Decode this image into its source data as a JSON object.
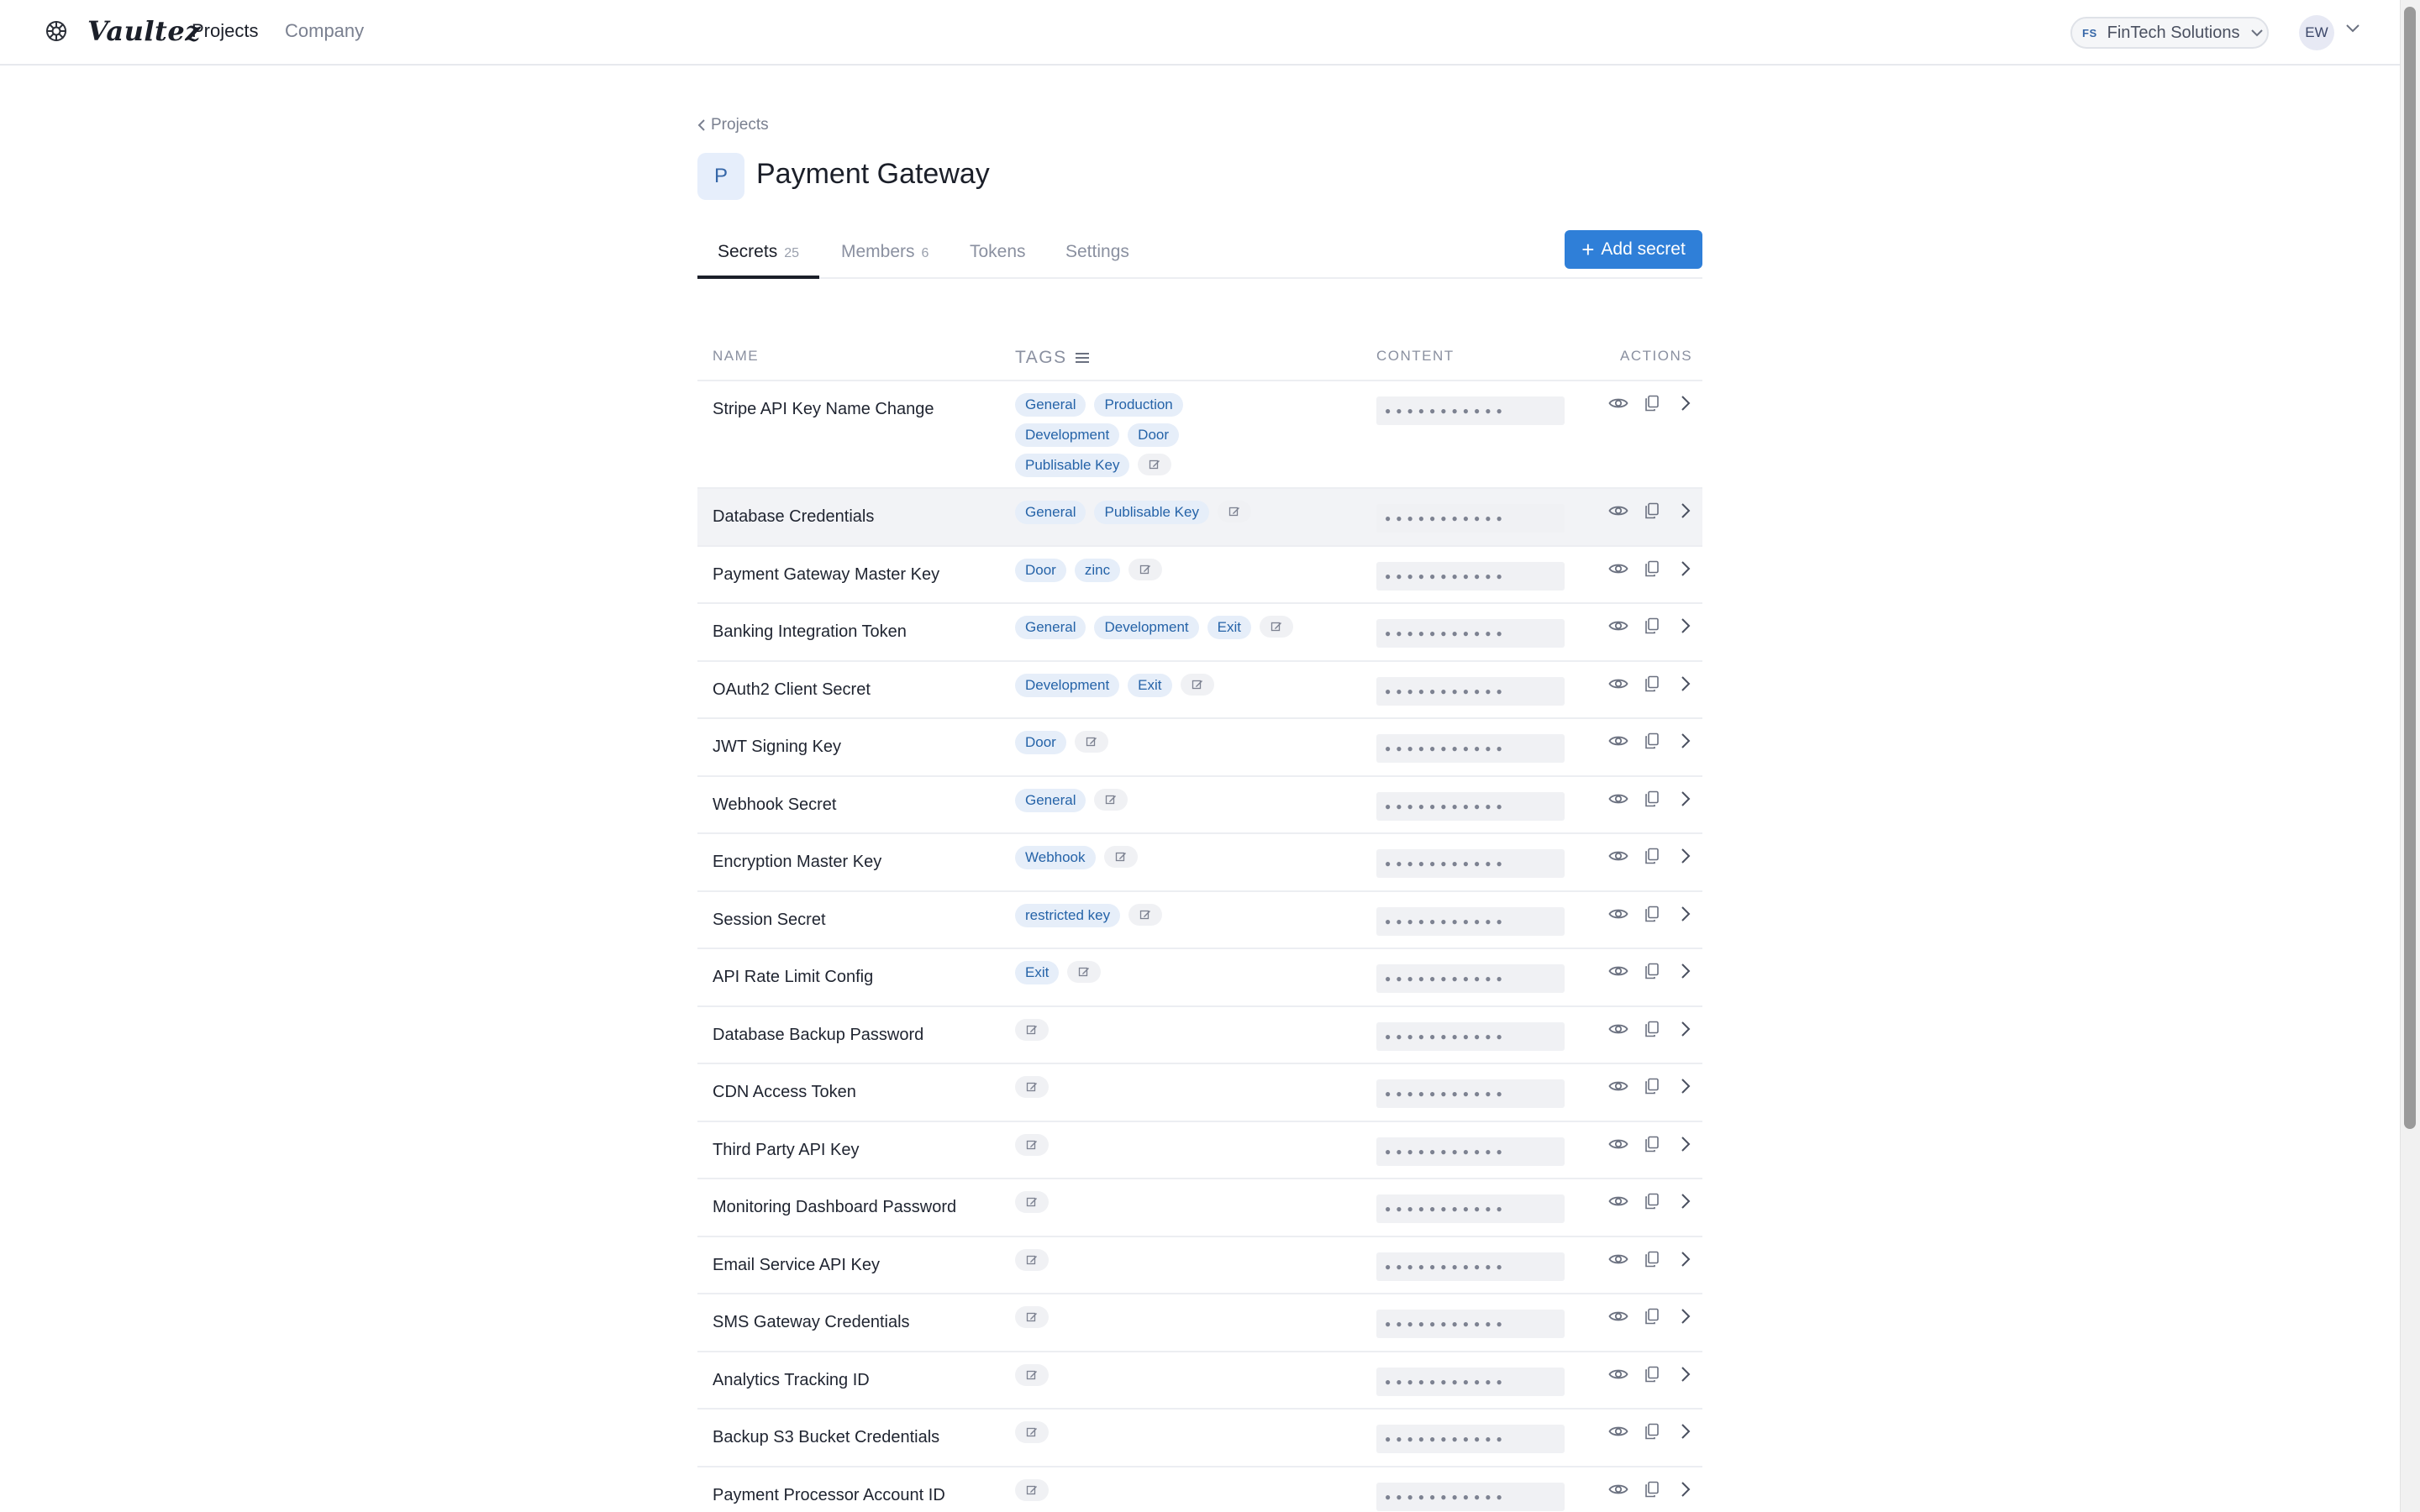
{
  "header": {
    "brand": "Vaultez",
    "nav": [
      {
        "label": "Projects",
        "active": true
      },
      {
        "label": "Company",
        "active": false
      }
    ],
    "org": {
      "badge": "FS",
      "name": "FinTech Solutions"
    },
    "user": {
      "initials": "EW"
    }
  },
  "page": {
    "back_label": "Projects",
    "project_initial": "P",
    "project_title": "Payment Gateway"
  },
  "tabs": [
    {
      "label": "Secrets",
      "count": "25",
      "active": true
    },
    {
      "label": "Members",
      "count": "6",
      "active": false
    },
    {
      "label": "Tokens",
      "count": "",
      "active": false
    },
    {
      "label": "Settings",
      "count": "",
      "active": false
    }
  ],
  "add_button": {
    "label": "Add secret"
  },
  "table": {
    "headers": {
      "name": "NAME",
      "tags": "TAGS",
      "content": "CONTENT",
      "actions": "ACTIONS"
    },
    "masked_value": "●●●●●●●●●●●",
    "rows": [
      {
        "name": "Stripe API Key Name Change",
        "tags": [
          "General",
          "Production",
          "Development",
          "Door",
          "Publisable Key"
        ]
      },
      {
        "name": "Database Credentials",
        "tags": [
          "General",
          "Publisable Key"
        ]
      },
      {
        "name": "Payment Gateway Master Key",
        "tags": [
          "Door",
          "zinc"
        ]
      },
      {
        "name": "Banking Integration Token",
        "tags": [
          "General",
          "Development",
          "Exit"
        ]
      },
      {
        "name": "OAuth2 Client Secret",
        "tags": [
          "Development",
          "Exit"
        ]
      },
      {
        "name": "JWT Signing Key",
        "tags": [
          "Door"
        ]
      },
      {
        "name": "Webhook Secret",
        "tags": [
          "General"
        ]
      },
      {
        "name": "Encryption Master Key",
        "tags": [
          "Webhook"
        ]
      },
      {
        "name": "Session Secret",
        "tags": [
          "restricted key"
        ]
      },
      {
        "name": "API Rate Limit Config",
        "tags": [
          "Exit"
        ]
      },
      {
        "name": "Database Backup Password",
        "tags": []
      },
      {
        "name": "CDN Access Token",
        "tags": []
      },
      {
        "name": "Third Party API Key",
        "tags": []
      },
      {
        "name": "Monitoring Dashboard Password",
        "tags": []
      },
      {
        "name": "Email Service API Key",
        "tags": []
      },
      {
        "name": "SMS Gateway Credentials",
        "tags": []
      },
      {
        "name": "Analytics Tracking ID",
        "tags": []
      },
      {
        "name": "Backup S3 Bucket Credentials",
        "tags": []
      },
      {
        "name": "Payment Processor Account ID",
        "tags": []
      }
    ]
  },
  "colors": {
    "accent": "#2f7fd8",
    "tag_bg": "#e6eef9",
    "tag_text": "#2563a8",
    "hover_row": "#f2f3f6"
  }
}
